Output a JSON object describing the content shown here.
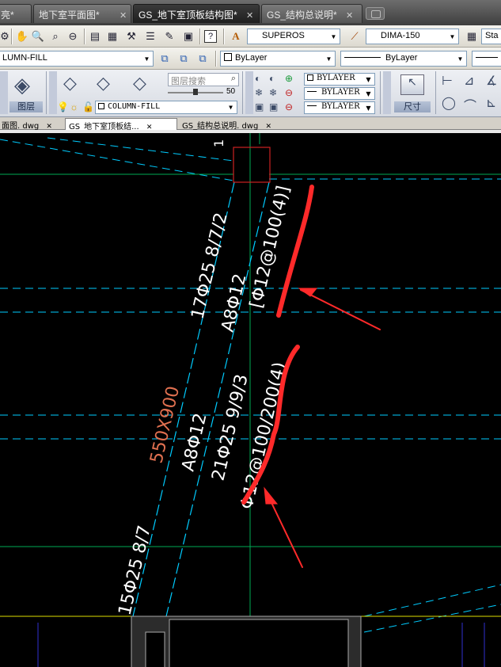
{
  "window_tabs": [
    {
      "label": "亮*",
      "active": false
    },
    {
      "label": "地下室平面图*",
      "active": false
    },
    {
      "label": "GS_地下室顶板结构图*",
      "active": true
    },
    {
      "label": "GS_结构总说明*",
      "active": false
    }
  ],
  "toolbar1": {
    "text_style": "SUPEROS",
    "dim_style": "DIMA-150",
    "table_style_partial": "Sta"
  },
  "toolbar2": {
    "layer": "LUMN-FILL",
    "color": "ByLayer",
    "linetype": "ByLayer"
  },
  "ribbon": {
    "layers_panel_label": "图层",
    "layer_search_placeholder": "图层搜索",
    "slider_value": "50",
    "current_layer": "COLUMN-FILL",
    "props": [
      "BYLAYER",
      "BYLAYER",
      "BYLAYER"
    ],
    "dim_panel_label": "尺寸"
  },
  "file_tabs": [
    {
      "label": "面图. dwg",
      "active": false
    },
    {
      "label": "GS_地下室顶板结...",
      "active": true
    },
    {
      "label": "GS_结构总说明. dwg",
      "active": false
    }
  ],
  "drawing": {
    "label_top_number": "1",
    "beam_top_rebar": "17Φ25 8/7/2",
    "beam_waist_rebar_1": "A8Φ12",
    "beam_stirrup_1": "[Φ12@100(4)]",
    "beam_size": "550X900",
    "beam_waist_rebar_2": "A8Φ12",
    "beam_mid_rebar": "21Φ25 9/9/3",
    "beam_stirrup_2": "Φ12@100/200(4)",
    "beam_bottom_rebar": "15Φ25 8/7"
  },
  "colors": {
    "cad_background": "#000000",
    "beam_line": "#00ccff",
    "axis_line": "#00aa55",
    "column": "#cc2222",
    "annotation_red": "#ff2a2a",
    "beam_size_text": "#e07050"
  }
}
